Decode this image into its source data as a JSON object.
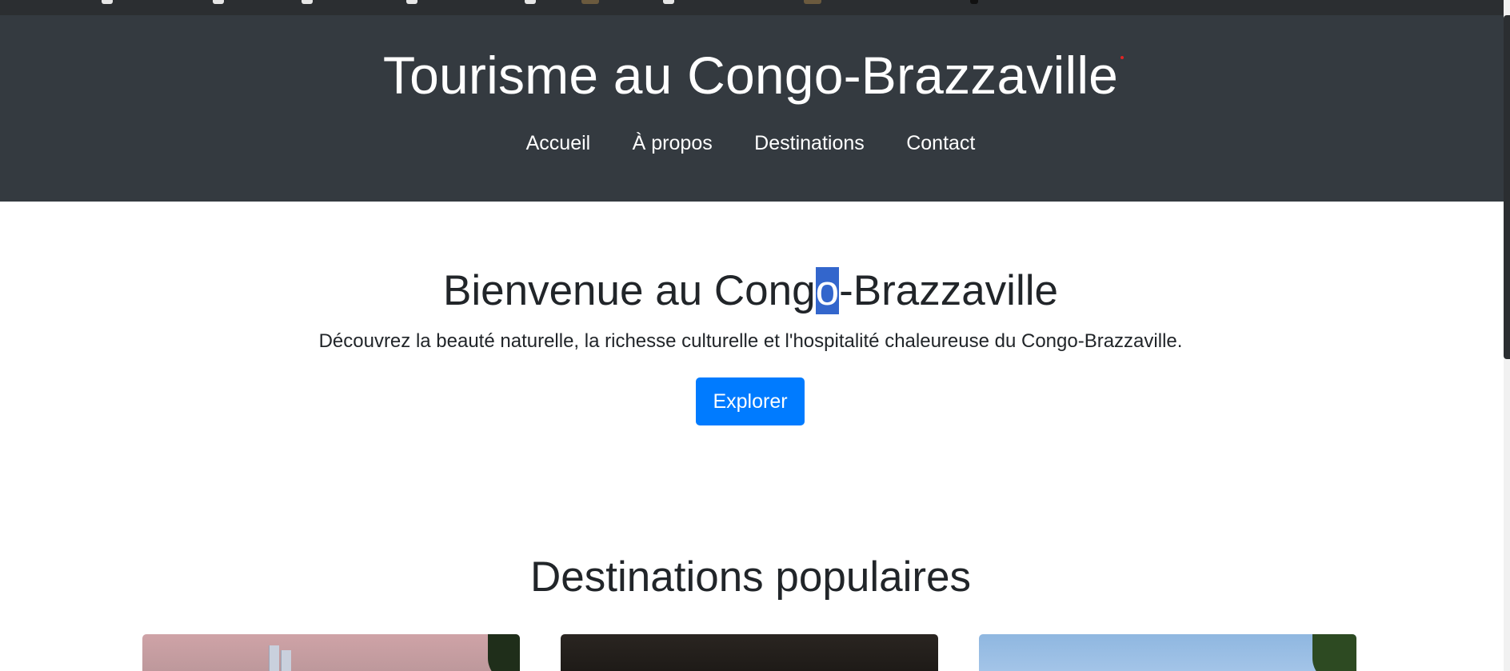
{
  "header": {
    "title": "Tourisme au Congo-Brazzaville",
    "nav": [
      "Accueil",
      "À propos",
      "Destinations",
      "Contact"
    ]
  },
  "hero": {
    "title_before": "Bienvenue au Cong",
    "title_selected": "o",
    "title_after": "-Brazzaville",
    "text": "Découvrez la beauté naturelle, la richesse culturelle et l'hospitalité chaleureuse du Congo-Brazzaville.",
    "button_label": "Explorer"
  },
  "destinations": {
    "title": "Destinations populaires"
  },
  "colors": {
    "header_bg": "#343a40",
    "primary_button": "#007bff",
    "selection": "#3366cc",
    "text": "#212529"
  }
}
